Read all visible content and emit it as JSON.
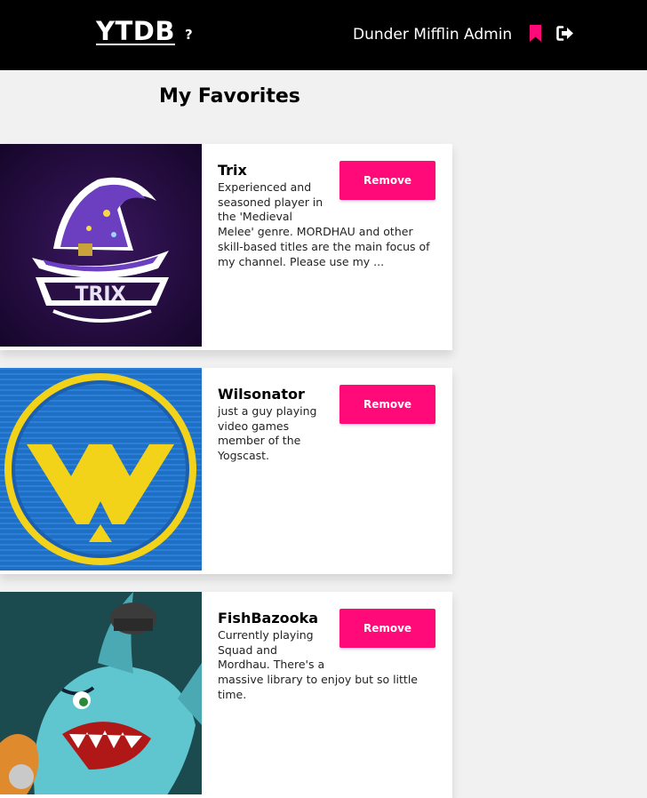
{
  "header": {
    "logo": "YTDB",
    "help": "?",
    "username": "Dunder Mifflin Admin",
    "icons": [
      "bookmark-icon",
      "sign-out-icon"
    ],
    "accent": "#ff0a78"
  },
  "main": {
    "title": "My Favorites"
  },
  "favorites": [
    {
      "name": "Trix",
      "description": "Experienced and seasoned player in the 'Medieval Melee' genre. MORDHAU and other skill-based titles are the main focus of my channel. Please use my ...",
      "remove_label": "Remove",
      "thumb_text": "TRIX"
    },
    {
      "name": "Wilsonator",
      "description": "just a guy playing video games member of the Yogscast.",
      "remove_label": "Remove"
    },
    {
      "name": "FishBazooka",
      "description": "Currently playing Squad and Mordhau. There's a massive library to enjoy but so little time.",
      "remove_label": "Remove"
    }
  ]
}
